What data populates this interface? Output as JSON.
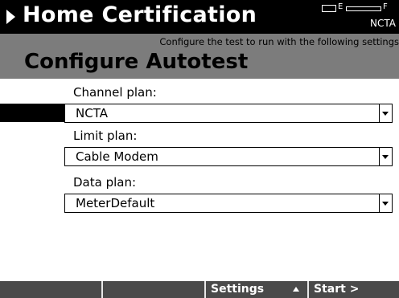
{
  "titlebar": {
    "title": "Home Certification",
    "battery_empty_label": "E",
    "battery_full_label": "F",
    "plan_tag": "NCTA"
  },
  "header": {
    "subtitle": "Configure the test to run with the following settings",
    "page_title": "Configure Autotest"
  },
  "form": {
    "channel_plan": {
      "label": "Channel plan:",
      "value": "NCTA"
    },
    "limit_plan": {
      "label": "Limit plan:",
      "value": "Cable Modem"
    },
    "data_plan": {
      "label": "Data plan:",
      "value": "MeterDefault"
    }
  },
  "softkeys": {
    "key1": "",
    "key2": "",
    "key3": "Settings",
    "key4": "Start >"
  }
}
